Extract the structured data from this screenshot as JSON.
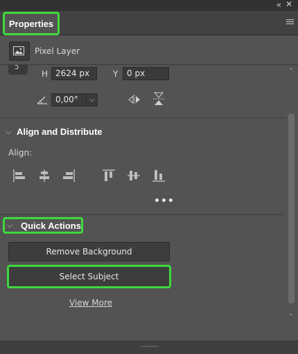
{
  "window": {
    "collapse_glyph": "«",
    "close_glyph": "✕"
  },
  "panel": {
    "tab_label": "Properties",
    "menu_icon": "hamburger-icon"
  },
  "layer": {
    "type_label": "Pixel Layer",
    "icon": "image-icon"
  },
  "transform": {
    "height_label": "H",
    "height_value": "2624 px",
    "y_label": "Y",
    "y_value": "0 px",
    "angle_value": "0,00°"
  },
  "align_section": {
    "title": "Align and Distribute",
    "align_label": "Align:",
    "more": "•••",
    "icons": [
      "align-left-edges-icon",
      "align-horizontal-centers-icon",
      "align-right-edges-icon",
      "align-top-edges-icon",
      "align-vertical-centers-icon",
      "align-bottom-edges-icon"
    ]
  },
  "quick_actions": {
    "title": "Quick Actions",
    "remove_background": "Remove Background",
    "select_subject": "Select Subject",
    "view_more": "View More"
  },
  "colors": {
    "highlight": "#3ed93e",
    "panel_bg": "#535353",
    "field_bg": "#3a3a3a"
  }
}
